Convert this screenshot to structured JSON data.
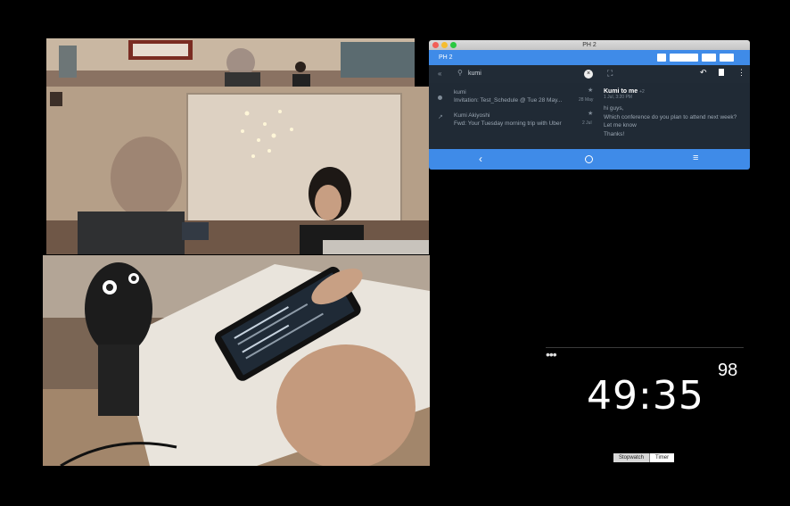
{
  "phone_window": {
    "title": "PH 2",
    "toolbar_label": "PH 2",
    "search": {
      "value": "kumi"
    },
    "mail_list": [
      {
        "sender": "kumi",
        "subject": "Invitation: Test_Schedule @ Tue 28 May...",
        "date": "28 May"
      },
      {
        "sender": "Kumi Akiyoshi",
        "subject": "Fwd: Your Tuesday morning trip with Uber",
        "date": "2 Jul"
      }
    ],
    "reader": {
      "from": "Kumi to me",
      "count": "+2",
      "date": "1 Jul, 3:20 PM",
      "body": [
        "hi guys,",
        "Which conference do you plan to attend next week?",
        "Let me know",
        "Thanks!"
      ]
    },
    "nav_icons": [
      "back-icon",
      "home-icon",
      "menu-icon"
    ],
    "colors": {
      "accent": "#3f8be8",
      "background": "#1d2733"
    }
  },
  "timer": {
    "menu": "•••",
    "minutes": "49",
    "separator": ":",
    "seconds": "35",
    "small": "98",
    "modes": [
      "Stopwatch",
      "Timer"
    ]
  }
}
